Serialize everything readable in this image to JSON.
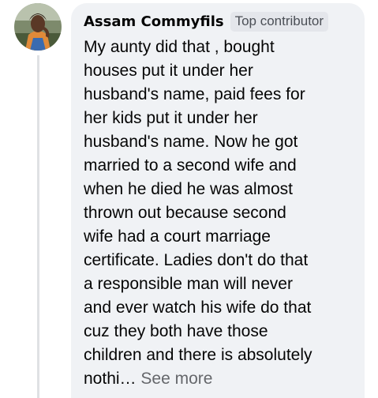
{
  "comment": {
    "author": "Assam Commyfils",
    "badge": "Top contributor",
    "lines": [
      "My aunty did that , bought",
      "houses put it under her",
      "husband's name, paid fees for",
      "her kids put it under her",
      "husband's name. Now he got",
      "married to a second wife and",
      "when he died he was almost",
      "thrown out because second",
      "wife had a court marriage",
      "certificate. Ladies don't do that",
      "a responsible man will never",
      "and ever watch his wife do that",
      "cuz they both have those",
      "children and there is absolutely"
    ],
    "truncated_tail": "nothi…",
    "see_more_label": "See more"
  },
  "colors": {
    "bubble_bg": "#f0f2f5",
    "badge_bg": "#e4e6eb",
    "text": "#050505",
    "muted": "#65676b"
  }
}
